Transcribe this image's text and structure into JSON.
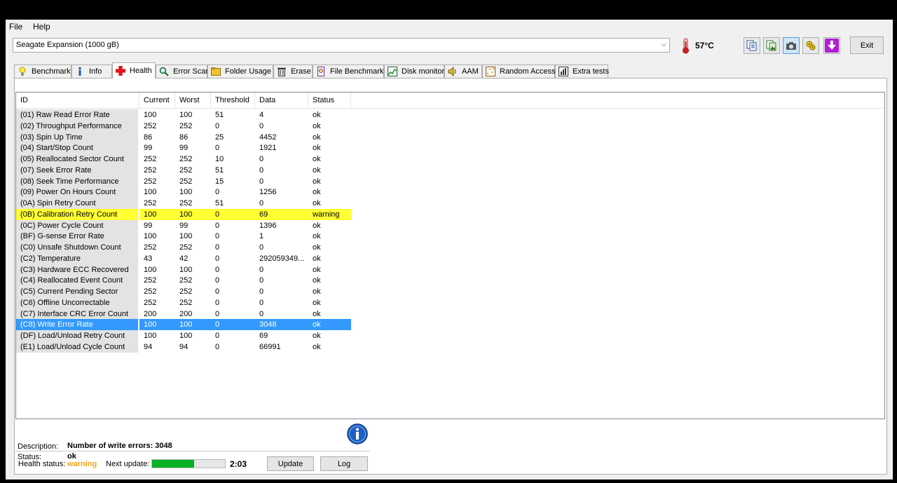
{
  "menu": {
    "file": "File",
    "help": "Help"
  },
  "toolbar": {
    "drive": "Seagate Expansion (1000 gB)",
    "temperature": "57°C",
    "exit_label": "Exit",
    "buttons": [
      "copy-text-icon",
      "copy-image-icon",
      "screenshot-icon",
      "options-icon",
      "save-icon"
    ]
  },
  "tabs": [
    {
      "label": "Benchmark",
      "icon": "benchmark-icon"
    },
    {
      "label": "Info",
      "icon": "info-icon"
    },
    {
      "label": "Health",
      "icon": "health-cross-icon"
    },
    {
      "label": "Error Scan",
      "icon": "magnifier-icon"
    },
    {
      "label": "Folder Usage",
      "icon": "folder-icon"
    },
    {
      "label": "Erase",
      "icon": "trash-icon"
    },
    {
      "label": "File Benchmark",
      "icon": "file-benchmark-icon"
    },
    {
      "label": "Disk monitor",
      "icon": "disk-monitor-icon"
    },
    {
      "label": "AAM",
      "icon": "speaker-icon"
    },
    {
      "label": "Random Access",
      "icon": "random-access-icon"
    },
    {
      "label": "Extra tests",
      "icon": "extra-tests-icon"
    }
  ],
  "active_tab": "Health",
  "table": {
    "columns": [
      "ID",
      "Current",
      "Worst",
      "Threshold",
      "Data",
      "Status"
    ],
    "rows": [
      [
        "(01) Raw Read Error Rate",
        "100",
        "100",
        "51",
        "4",
        "ok"
      ],
      [
        "(02) Throughput Performance",
        "252",
        "252",
        "0",
        "0",
        "ok"
      ],
      [
        "(03) Spin Up Time",
        "86",
        "86",
        "25",
        "4452",
        "ok"
      ],
      [
        "(04) Start/Stop Count",
        "99",
        "99",
        "0",
        "1921",
        "ok"
      ],
      [
        "(05) Reallocated Sector Count",
        "252",
        "252",
        "10",
        "0",
        "ok"
      ],
      [
        "(07) Seek Error Rate",
        "252",
        "252",
        "51",
        "0",
        "ok"
      ],
      [
        "(08) Seek Time Performance",
        "252",
        "252",
        "15",
        "0",
        "ok"
      ],
      [
        "(09) Power On Hours Count",
        "100",
        "100",
        "0",
        "1256",
        "ok"
      ],
      [
        "(0A) Spin Retry Count",
        "252",
        "252",
        "51",
        "0",
        "ok"
      ],
      [
        "(0B) Calibration Retry Count",
        "100",
        "100",
        "0",
        "69",
        "warning"
      ],
      [
        "(0C) Power Cycle Count",
        "99",
        "99",
        "0",
        "1396",
        "ok"
      ],
      [
        "(BF) G-sense Error Rate",
        "100",
        "100",
        "0",
        "1",
        "ok"
      ],
      [
        "(C0) Unsafe Shutdown Count",
        "252",
        "252",
        "0",
        "0",
        "ok"
      ],
      [
        "(C2) Temperature",
        "43",
        "42",
        "0",
        "292059349...",
        "ok"
      ],
      [
        "(C3) Hardware ECC Recovered",
        "100",
        "100",
        "0",
        "0",
        "ok"
      ],
      [
        "(C4) Reallocated Event Count",
        "252",
        "252",
        "0",
        "0",
        "ok"
      ],
      [
        "(C5) Current Pending Sector",
        "252",
        "252",
        "0",
        "0",
        "ok"
      ],
      [
        "(C6) Offline Uncorrectable",
        "252",
        "252",
        "0",
        "0",
        "ok"
      ],
      [
        "(C7) Interface CRC Error Count",
        "200",
        "200",
        "0",
        "0",
        "ok"
      ],
      [
        "(C8) Write Error Rate",
        "100",
        "100",
        "0",
        "3048",
        "ok"
      ],
      [
        "(DF) Load/Unload Retry Count",
        "100",
        "100",
        "0",
        "69",
        "ok"
      ],
      [
        "(E1) Load/Unload Cycle Count",
        "94",
        "94",
        "0",
        "66991",
        "ok"
      ]
    ],
    "warning_row": 9,
    "selected_row": 19
  },
  "details": {
    "description_label": "Description:",
    "description_value": "Number of write errors: 3048",
    "status_label": "Status:",
    "status_value": "ok"
  },
  "footer": {
    "health_status_label": "Health status:",
    "health_status_value": "warning",
    "next_update_label": "Next update:",
    "progress_fraction": 0.58,
    "countdown": "2:03",
    "update_label": "Update",
    "log_label": "Log"
  },
  "colors": {
    "warning_row": "#ffff33",
    "selected_row": "#3399ff",
    "health_warning_text": "#f7a51c",
    "progress_fill": "#06b025"
  }
}
